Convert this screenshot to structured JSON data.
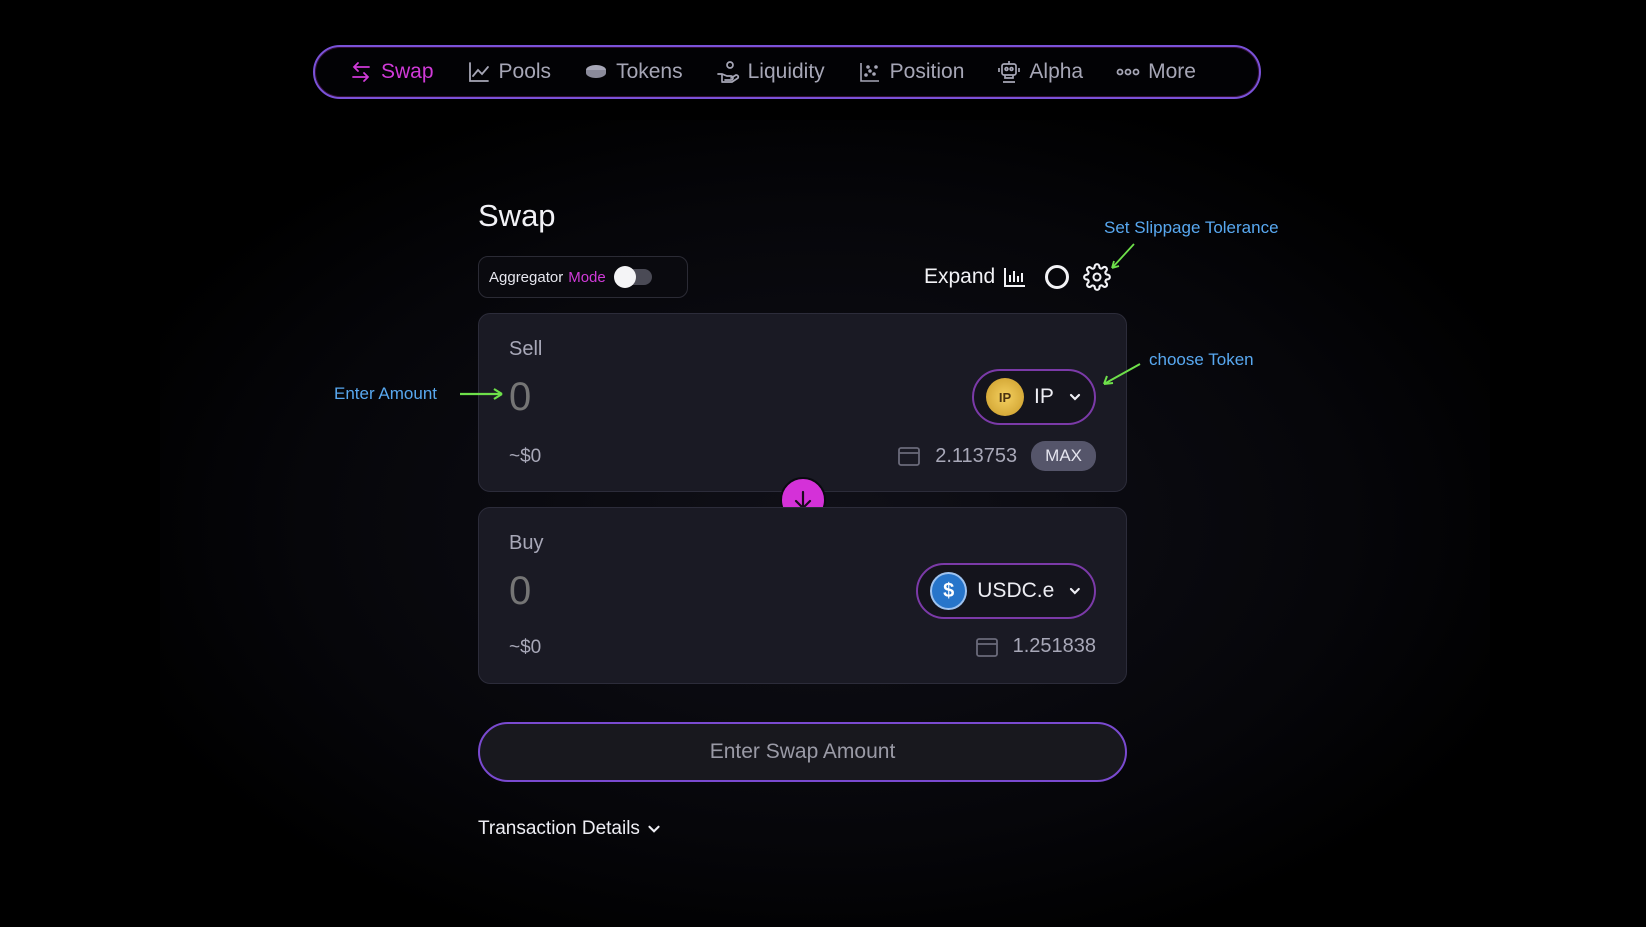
{
  "nav": {
    "items": [
      {
        "label": "Swap",
        "icon": "swap-arrows-icon",
        "active": true
      },
      {
        "label": "Pools",
        "icon": "line-chart-icon"
      },
      {
        "label": "Tokens",
        "icon": "coin-icon"
      },
      {
        "label": "Liquidity",
        "icon": "hand-coins-icon"
      },
      {
        "label": "Position",
        "icon": "scatter-chart-icon"
      },
      {
        "label": "Alpha",
        "icon": "robot-icon"
      },
      {
        "label": "More",
        "icon": "dots-icon"
      }
    ]
  },
  "swap": {
    "title": "Swap",
    "aggregator_word1": "Aggregator",
    "aggregator_word2": "Mode",
    "aggregator_enabled": false,
    "expand_label": "Expand",
    "sell": {
      "label": "Sell",
      "amount": "0",
      "usd": "~$0",
      "token": "IP",
      "token_logo_text": "IP",
      "balance": "2.113753",
      "max_label": "MAX"
    },
    "buy": {
      "label": "Buy",
      "amount": "0",
      "usd": "~$0",
      "token": "USDC.e",
      "token_logo_text": "$",
      "balance": "1.251838"
    },
    "cta_label": "Enter Swap Amount",
    "details_label": "Transaction Details"
  },
  "annotations": {
    "slippage": "Set Slippage Tolerance",
    "token": "choose Token",
    "amount": "Enter Amount"
  },
  "colors": {
    "accent": "#d03ad8",
    "annotation": "#58a8f0",
    "arrow": "#6ee04a"
  }
}
